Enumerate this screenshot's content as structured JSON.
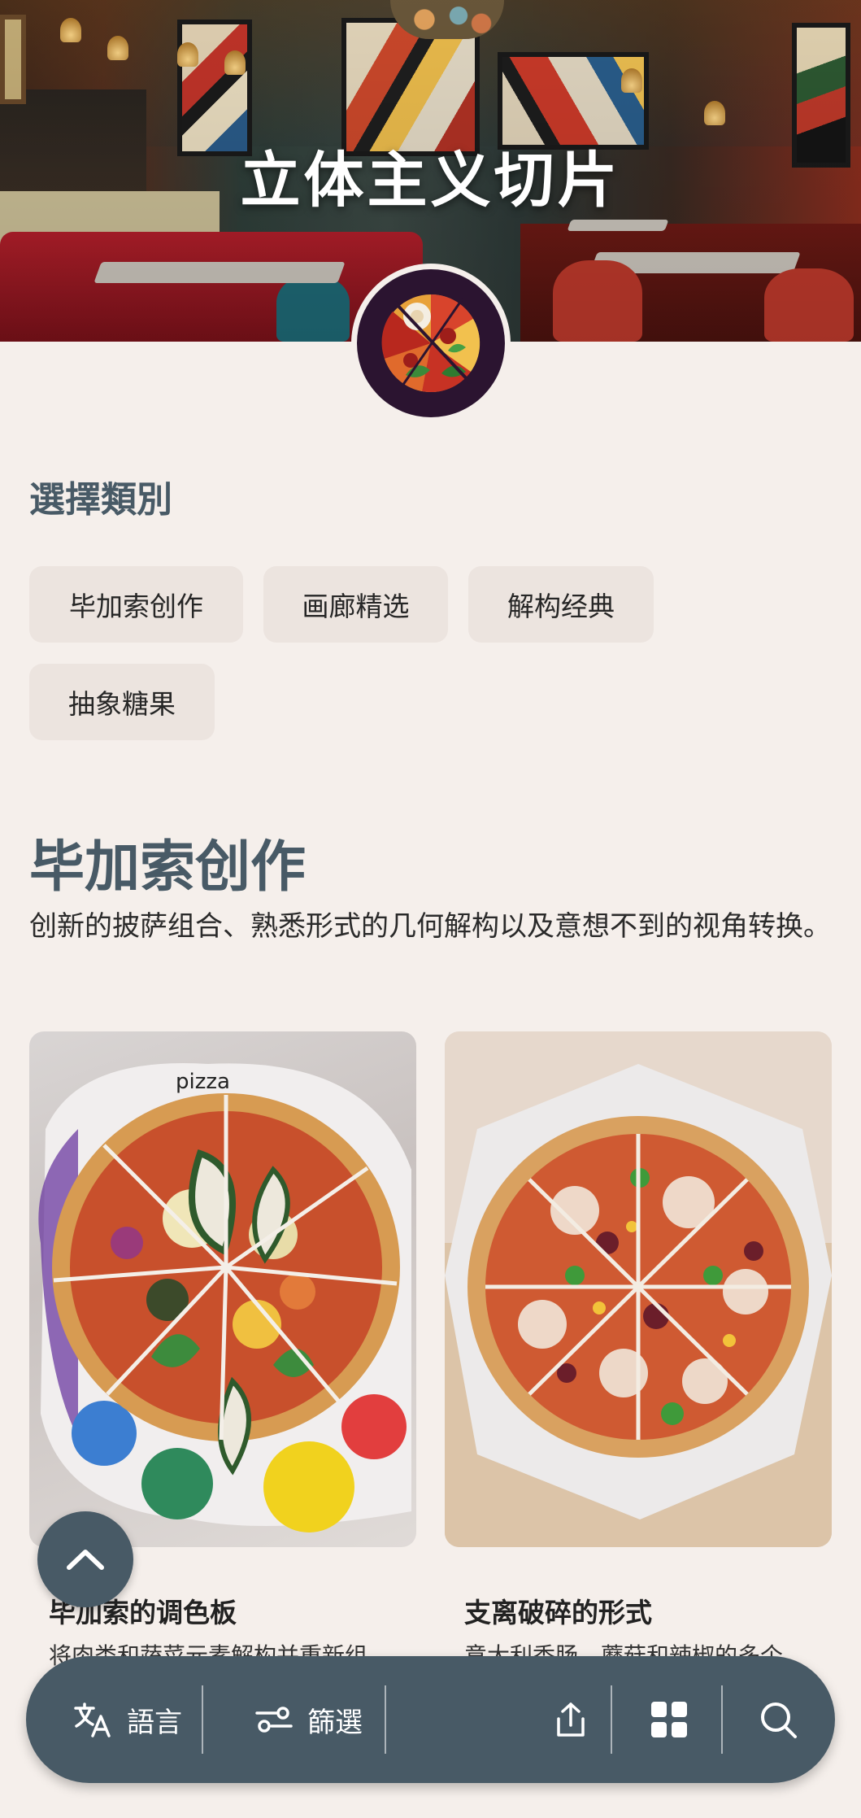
{
  "hero": {
    "title": "立体主义切片"
  },
  "categories": {
    "heading": "選擇類別",
    "chips": [
      "毕加索创作",
      "画廊精选",
      "解构经典",
      "抽象糖果"
    ]
  },
  "section": {
    "title": "毕加索创作",
    "description": "创新的披萨组合、熟悉形式的几何解构以及意想不到的视角转换。"
  },
  "cards": [
    {
      "name": "毕加索的调色板",
      "snippet": "将肉类和蔬菜元素解构并重新组",
      "plate_text": "pizza"
    },
    {
      "name": "支离破碎的形式",
      "snippet": "意大利香肠、蘑菇和辣椒的多个"
    }
  ],
  "bottom_bar": {
    "language_label": "語言",
    "filter_label": "篩選"
  },
  "colors": {
    "accent": "#485a66",
    "background": "#f5efeb",
    "chip": "#ece4df"
  },
  "icons": [
    "translate-icon",
    "filter-icon",
    "share-icon",
    "grid-icon",
    "search-icon",
    "chevron-up-icon"
  ]
}
